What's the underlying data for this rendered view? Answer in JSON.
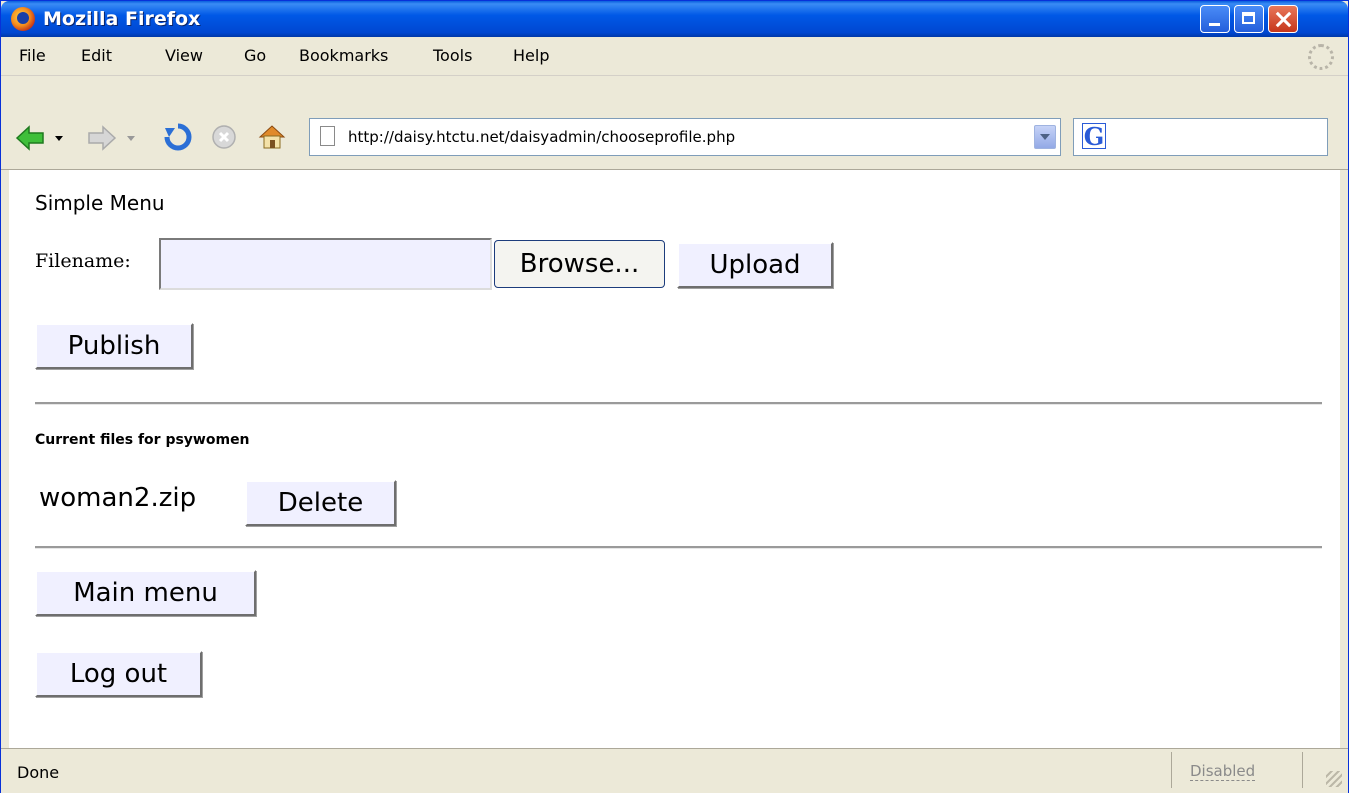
{
  "window": {
    "title": "Mozilla Firefox"
  },
  "menubar": {
    "items": [
      "File",
      "Edit",
      "View",
      "Go",
      "Bookmarks",
      "Tools",
      "Help"
    ]
  },
  "navbar": {
    "url": "http://daisy.htctu.net/daisyadmin/chooseprofile.php",
    "search_icon": "G"
  },
  "page": {
    "heading": "Simple Menu",
    "filename_label": "Filename:",
    "filename_value": "",
    "browse_label": "Browse...",
    "upload_label": "Upload",
    "publish_label": "Publish",
    "files_heading": "Current files for psywomen",
    "files": [
      {
        "name": "woman2.zip",
        "delete_label": "Delete"
      }
    ],
    "main_menu_label": "Main menu",
    "logout_label": "Log out"
  },
  "statusbar": {
    "status": "Done",
    "panel": "Disabled"
  },
  "colors": {
    "titlebar": "#0058e6",
    "chrome": "#ece9d8",
    "button_bg": "#f0f0ff",
    "close_button": "#c6361b"
  },
  "icons": [
    "firefox-logo-icon",
    "back-arrow-icon",
    "forward-arrow-icon",
    "reload-icon",
    "stop-icon",
    "home-icon",
    "page-icon",
    "dropdown-icon",
    "google-search-icon",
    "throbber-icon",
    "resize-grip-icon"
  ]
}
